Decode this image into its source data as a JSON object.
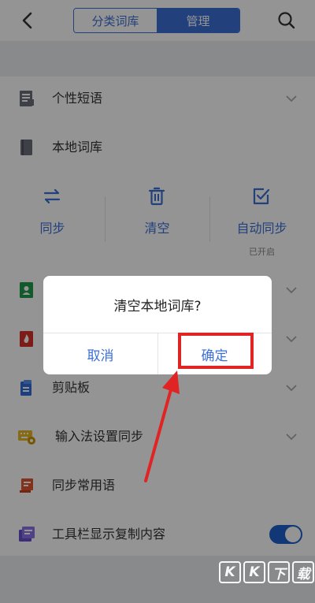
{
  "header": {
    "tabs": [
      "分类词库",
      "管理"
    ],
    "active_tab": "管理"
  },
  "rows": [
    {
      "label": "个性短语",
      "icon": "document-list-icon",
      "has_chevron": true
    },
    {
      "label": "本地词库",
      "icon": "book-icon",
      "has_chevron": false
    }
  ],
  "actions": [
    {
      "label": "同步",
      "icon": "sync-arrows-icon",
      "sub": ""
    },
    {
      "label": "清空",
      "icon": "trash-icon",
      "sub": ""
    },
    {
      "label": "自动同步",
      "icon": "checkbox-icon",
      "sub": "已开启"
    }
  ],
  "lower_rows": [
    {
      "label": "",
      "icon": "contacts-book-icon",
      "has_chevron": true
    },
    {
      "label": "",
      "icon": "fire-book-icon",
      "has_chevron": true
    },
    {
      "label": "剪贴板",
      "icon": "clipboard-icon",
      "has_chevron": true
    },
    {
      "label": "输入法设置同步",
      "icon": "keyboard-gear-icon",
      "has_chevron": true
    },
    {
      "label": "同步常用语",
      "icon": "phrase-board-icon",
      "has_chevron": false
    },
    {
      "label": "工具栏显示复制内容",
      "icon": "toolbar-copy-icon",
      "has_chevron": false,
      "toggle_on": true
    }
  ],
  "dialog": {
    "title": "清空本地词库?",
    "cancel": "取消",
    "confirm": "确定"
  },
  "watermark": [
    "K",
    "K",
    "下",
    "载"
  ],
  "colors": {
    "accent": "#3b6fd6",
    "highlight": "#e02424",
    "toggle": "#1f5fcc"
  }
}
